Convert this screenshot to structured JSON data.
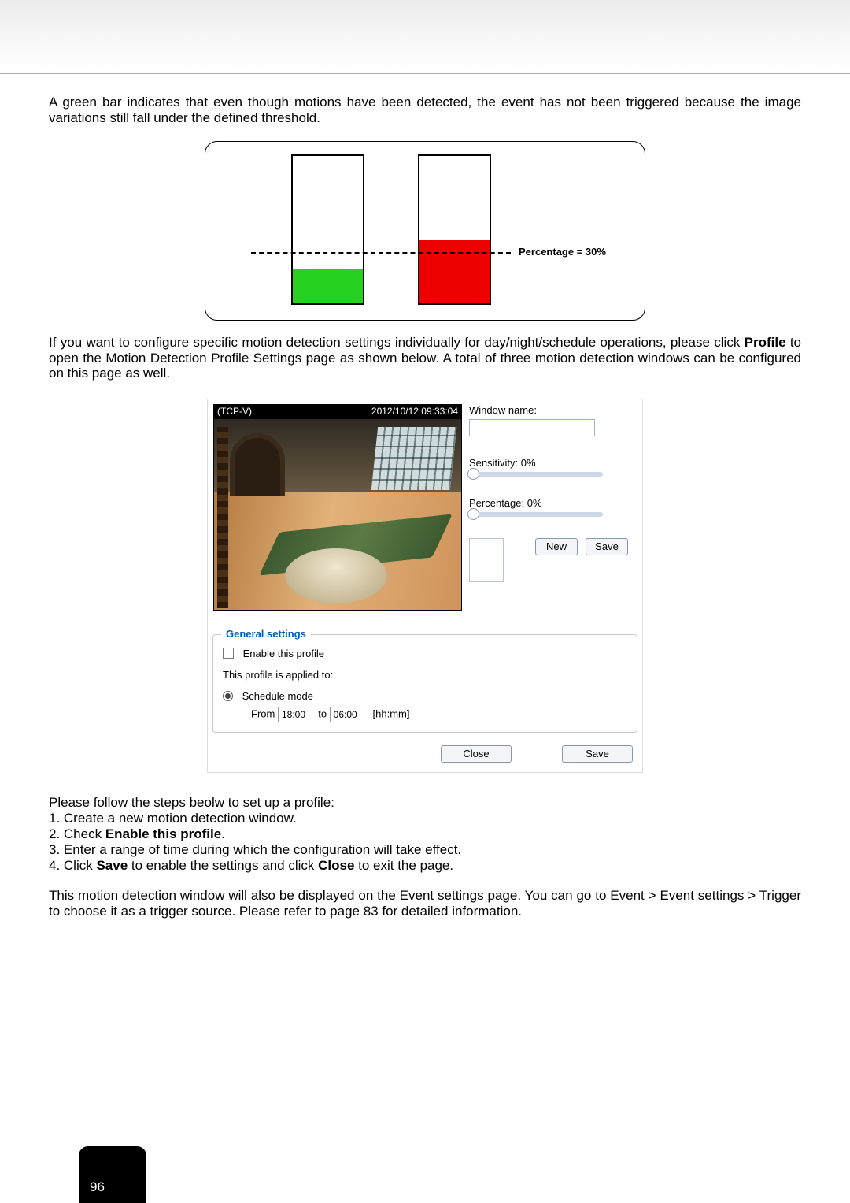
{
  "intro_para": "A green bar indicates that even though motions have been detected, the event has not been triggered because the image variations still fall under the defined threshold.",
  "chart_data": {
    "type": "bar",
    "categories": [
      "Green bar",
      "Red bar"
    ],
    "values": [
      23,
      43
    ],
    "threshold_label": "Percentage = 30%",
    "threshold_value": 30,
    "ylim": [
      0,
      100
    ],
    "title": "",
    "xlabel": "",
    "ylabel": ""
  },
  "profile_para_prefix": "If you want to configure specific motion detection settings individually for day/night/schedule operations, please click ",
  "profile_bold": "Profile",
  "profile_para_suffix": " to open the Motion Detection Profile Settings page as shown below. A total of three motion detection windows can be configured on this page as well.",
  "camera": {
    "source": "(TCP-V)",
    "timestamp": "2012/10/12 09:33:04"
  },
  "controls": {
    "window_name_label": "Window name:",
    "window_name_value": "",
    "sensitivity_label": "Sensitivity: 0%",
    "sensitivity_value": 0,
    "percentage_label": "Percentage: 0%",
    "percentage_value": 0,
    "new_btn": "New",
    "save_btn": "Save"
  },
  "general": {
    "title": "General settings",
    "enable_label": "Enable this profile",
    "applied_label": "This profile is applied to:",
    "schedule_label": "Schedule mode",
    "from_label": "From",
    "from_value": "18:00",
    "to_label": "to",
    "to_value": "06:00",
    "format_hint": "[hh:mm]"
  },
  "bottom": {
    "close": "Close",
    "save": "Save"
  },
  "steps": {
    "intro": "Please follow the steps beolw to set up a profile:",
    "s1": "1. Create a new motion detection window.",
    "s2_prefix": "2. Check ",
    "s2_bold": "Enable this profile",
    "s2_suffix": ".",
    "s3": "3. Enter a range of time during which the configuration will take effect.",
    "s4_prefix": "4. Click ",
    "s4_bold1": "Save",
    "s4_mid": " to enable the settings and click ",
    "s4_bold2": "Close",
    "s4_suffix": " to exit the page."
  },
  "note": "This motion detection window will also be displayed on the Event settings page. You can go to Event > Event settings > Trigger to choose it as a trigger source. Please refer to page 83 for detailed information.",
  "page_number": "96"
}
